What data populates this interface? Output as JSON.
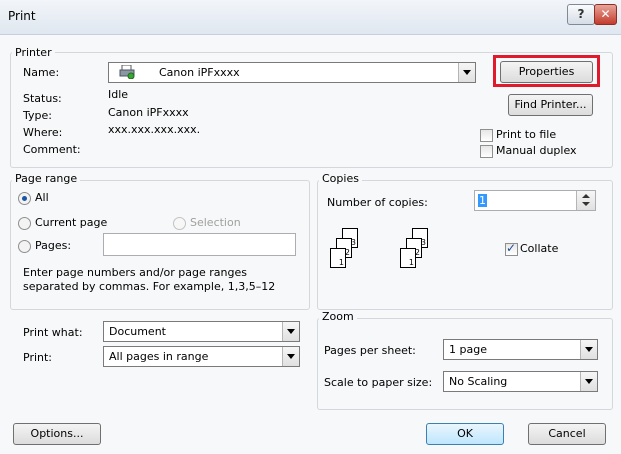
{
  "window": {
    "title": "Print",
    "help_label": "?",
    "close_label": "✕"
  },
  "printer": {
    "group_label": "Printer",
    "name_label": "Name:",
    "name_value": "Canon iPFxxxx",
    "status_label": "Status:",
    "status_value": "Idle",
    "type_label": "Type:",
    "type_value": "Canon iPFxxxx",
    "where_label": "Where:",
    "where_value": "xxx.xxx.xxx.xxx.",
    "comment_label": "Comment:",
    "properties_label": "Properties",
    "find_printer_label": "Find Printer...",
    "print_to_file_label": "Print to file",
    "manual_duplex_label": "Manual duplex",
    "highlight_color": "#e0192c"
  },
  "page_range": {
    "group_label": "Page range",
    "all_label": "All",
    "current_page_label": "Current page",
    "selection_label": "Selection",
    "pages_label": "Pages:",
    "hint_line1": "Enter page numbers and/or page ranges",
    "hint_line2": "separated by commas.  For example, 1,3,5–12"
  },
  "copies": {
    "group_label": "Copies",
    "number_label": "Number of copies:",
    "number_value": "1",
    "collate_label": "Collate",
    "collate_checked": true,
    "illustration_pages": [
      "1",
      "2",
      "3"
    ]
  },
  "print_what": {
    "label": "Print what:",
    "value": "Document"
  },
  "print": {
    "label": "Print:",
    "value": "All pages in range"
  },
  "zoom": {
    "group_label": "Zoom",
    "pages_per_sheet_label": "Pages per sheet:",
    "pages_per_sheet_value": "1 page",
    "scale_label": "Scale to paper size:",
    "scale_value": "No Scaling"
  },
  "footer": {
    "options_label": "Options...",
    "ok_label": "OK",
    "cancel_label": "Cancel"
  }
}
